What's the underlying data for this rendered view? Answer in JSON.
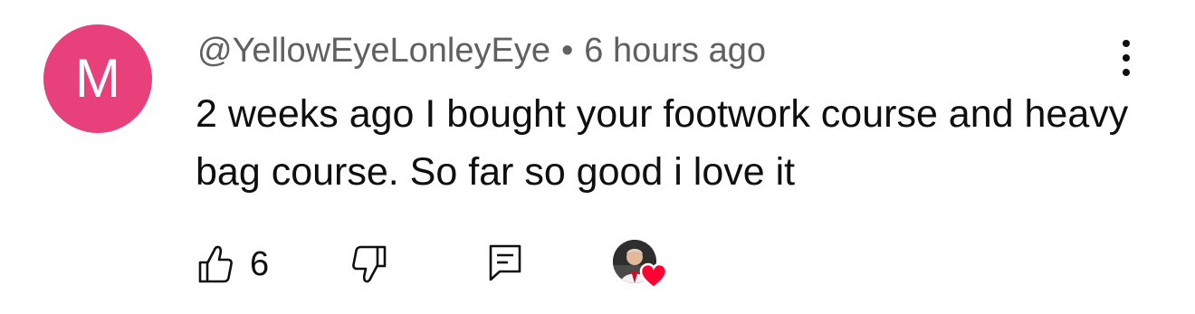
{
  "comment": {
    "avatar_letter": "M",
    "avatar_color": "#e8407a",
    "username": "@YellowEyeLonleyEye",
    "separator": "•",
    "timestamp": "6 hours ago",
    "text": "2 weeks ago I bought your footwork course and heavy bag course. So far so good i love it",
    "menu_icon": "more-vertical-icon"
  },
  "actions": {
    "like_icon": "thumbs-up-icon",
    "like_count": "6",
    "dislike_icon": "thumbs-down-icon",
    "reply_icon": "comment-reply-icon",
    "creator_heart_icon": "heart-icon",
    "heart_color": "#ff0033"
  }
}
